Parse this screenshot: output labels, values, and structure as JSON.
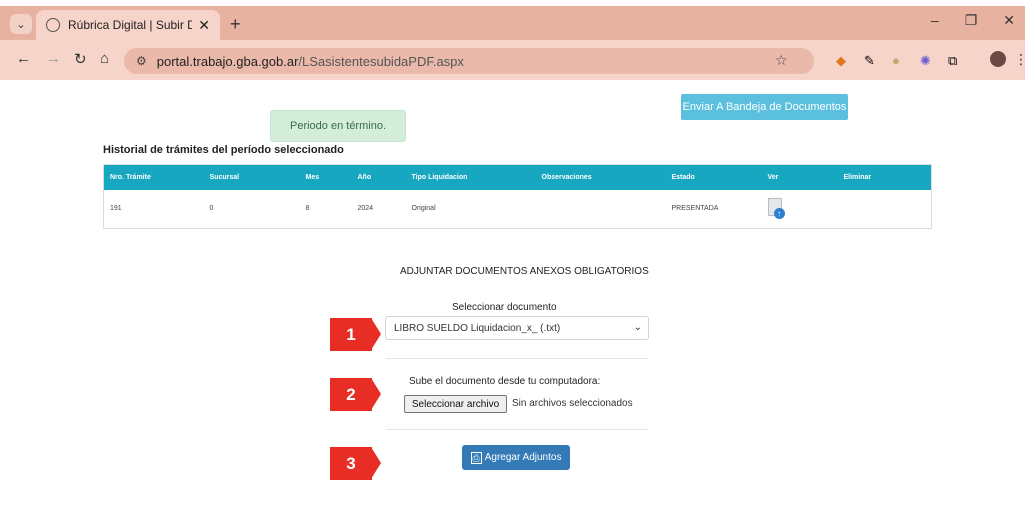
{
  "browser": {
    "tab_title": "Rúbrica Digital | Subir Documen",
    "url_domain": "portal.trabajo.gba.gob.ar",
    "url_path": "/LSasistentesubidaPDF.aspx"
  },
  "page": {
    "status_message": "Periodo en término.",
    "send_button": "Enviar A Bandeja de Documentos",
    "history_title": "Historial de trámites del período seleccionado",
    "table": {
      "headers": [
        "Nro. Trámite",
        "Sucursal",
        "Mes",
        "Año",
        "Tipo Liquidacion",
        "Observaciones",
        "Estado",
        "Ver",
        "Eliminar"
      ],
      "row": {
        "nro": "191",
        "sucursal": "0",
        "mes": "8",
        "anio": "2024",
        "tipo": "Original",
        "observaciones": "",
        "estado": "PRESENTADA"
      }
    },
    "adjuntar_title": "ADJUNTAR DOCUMENTOS ANEXOS OBLIGATORIOS",
    "select_label": "Seleccionar documento",
    "select_value": "LIBRO SUELDO Liquidacion_x_ (.txt)",
    "upload_label": "Sube el documento desde tu computadora:",
    "file_button": "Seleccionar archivo",
    "file_status": "Sin archivos seleccionados",
    "add_button": "Agregar Adjuntos",
    "markers": [
      "1",
      "2",
      "3"
    ],
    "marker_color": "#e82d25",
    "accent_color": "#17a7c1"
  }
}
